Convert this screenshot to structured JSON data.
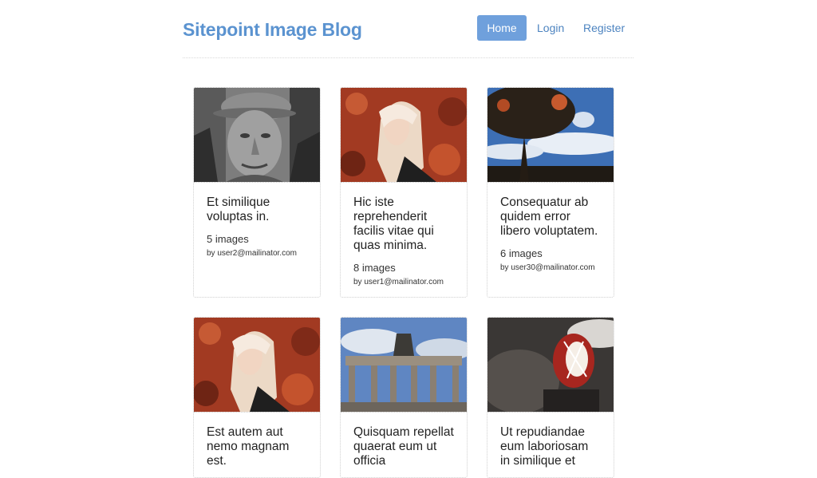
{
  "header": {
    "brand": "Sitepoint Image Blog",
    "nav": {
      "home": "Home",
      "login": "Login",
      "register": "Register"
    }
  },
  "galleries": [
    {
      "title": "Et similique voluptas in.",
      "count": "5 images",
      "author": "by user2@mailinator.com",
      "image": "portrait-old-man-cap-grayscale"
    },
    {
      "title": "Hic iste reprehenderit facilis vitae qui quas minima.",
      "count": "8 images",
      "author": "by user1@mailinator.com",
      "image": "portrait-blonde-woman-red-leaves"
    },
    {
      "title": "Consequatur ab quidem error libero voluptatem.",
      "count": "6 images",
      "author": "by user30@mailinator.com",
      "image": "tree-silhouette-sky"
    },
    {
      "title": "Est autem aut nemo magnam est.",
      "count": "",
      "author": "",
      "image": "portrait-blonde-woman-red-leaves"
    },
    {
      "title": "Quisquam repellat quaerat eum ut officia",
      "count": "",
      "author": "",
      "image": "brandenburg-gate"
    },
    {
      "title": "Ut repudiandae eum laboriosam in similique et",
      "count": "",
      "author": "",
      "image": "orange-lamp-closeup"
    }
  ],
  "colors": {
    "brand": "#5b93d0",
    "nav_active_bg": "#6fa0dc",
    "link": "#4d84c0"
  }
}
